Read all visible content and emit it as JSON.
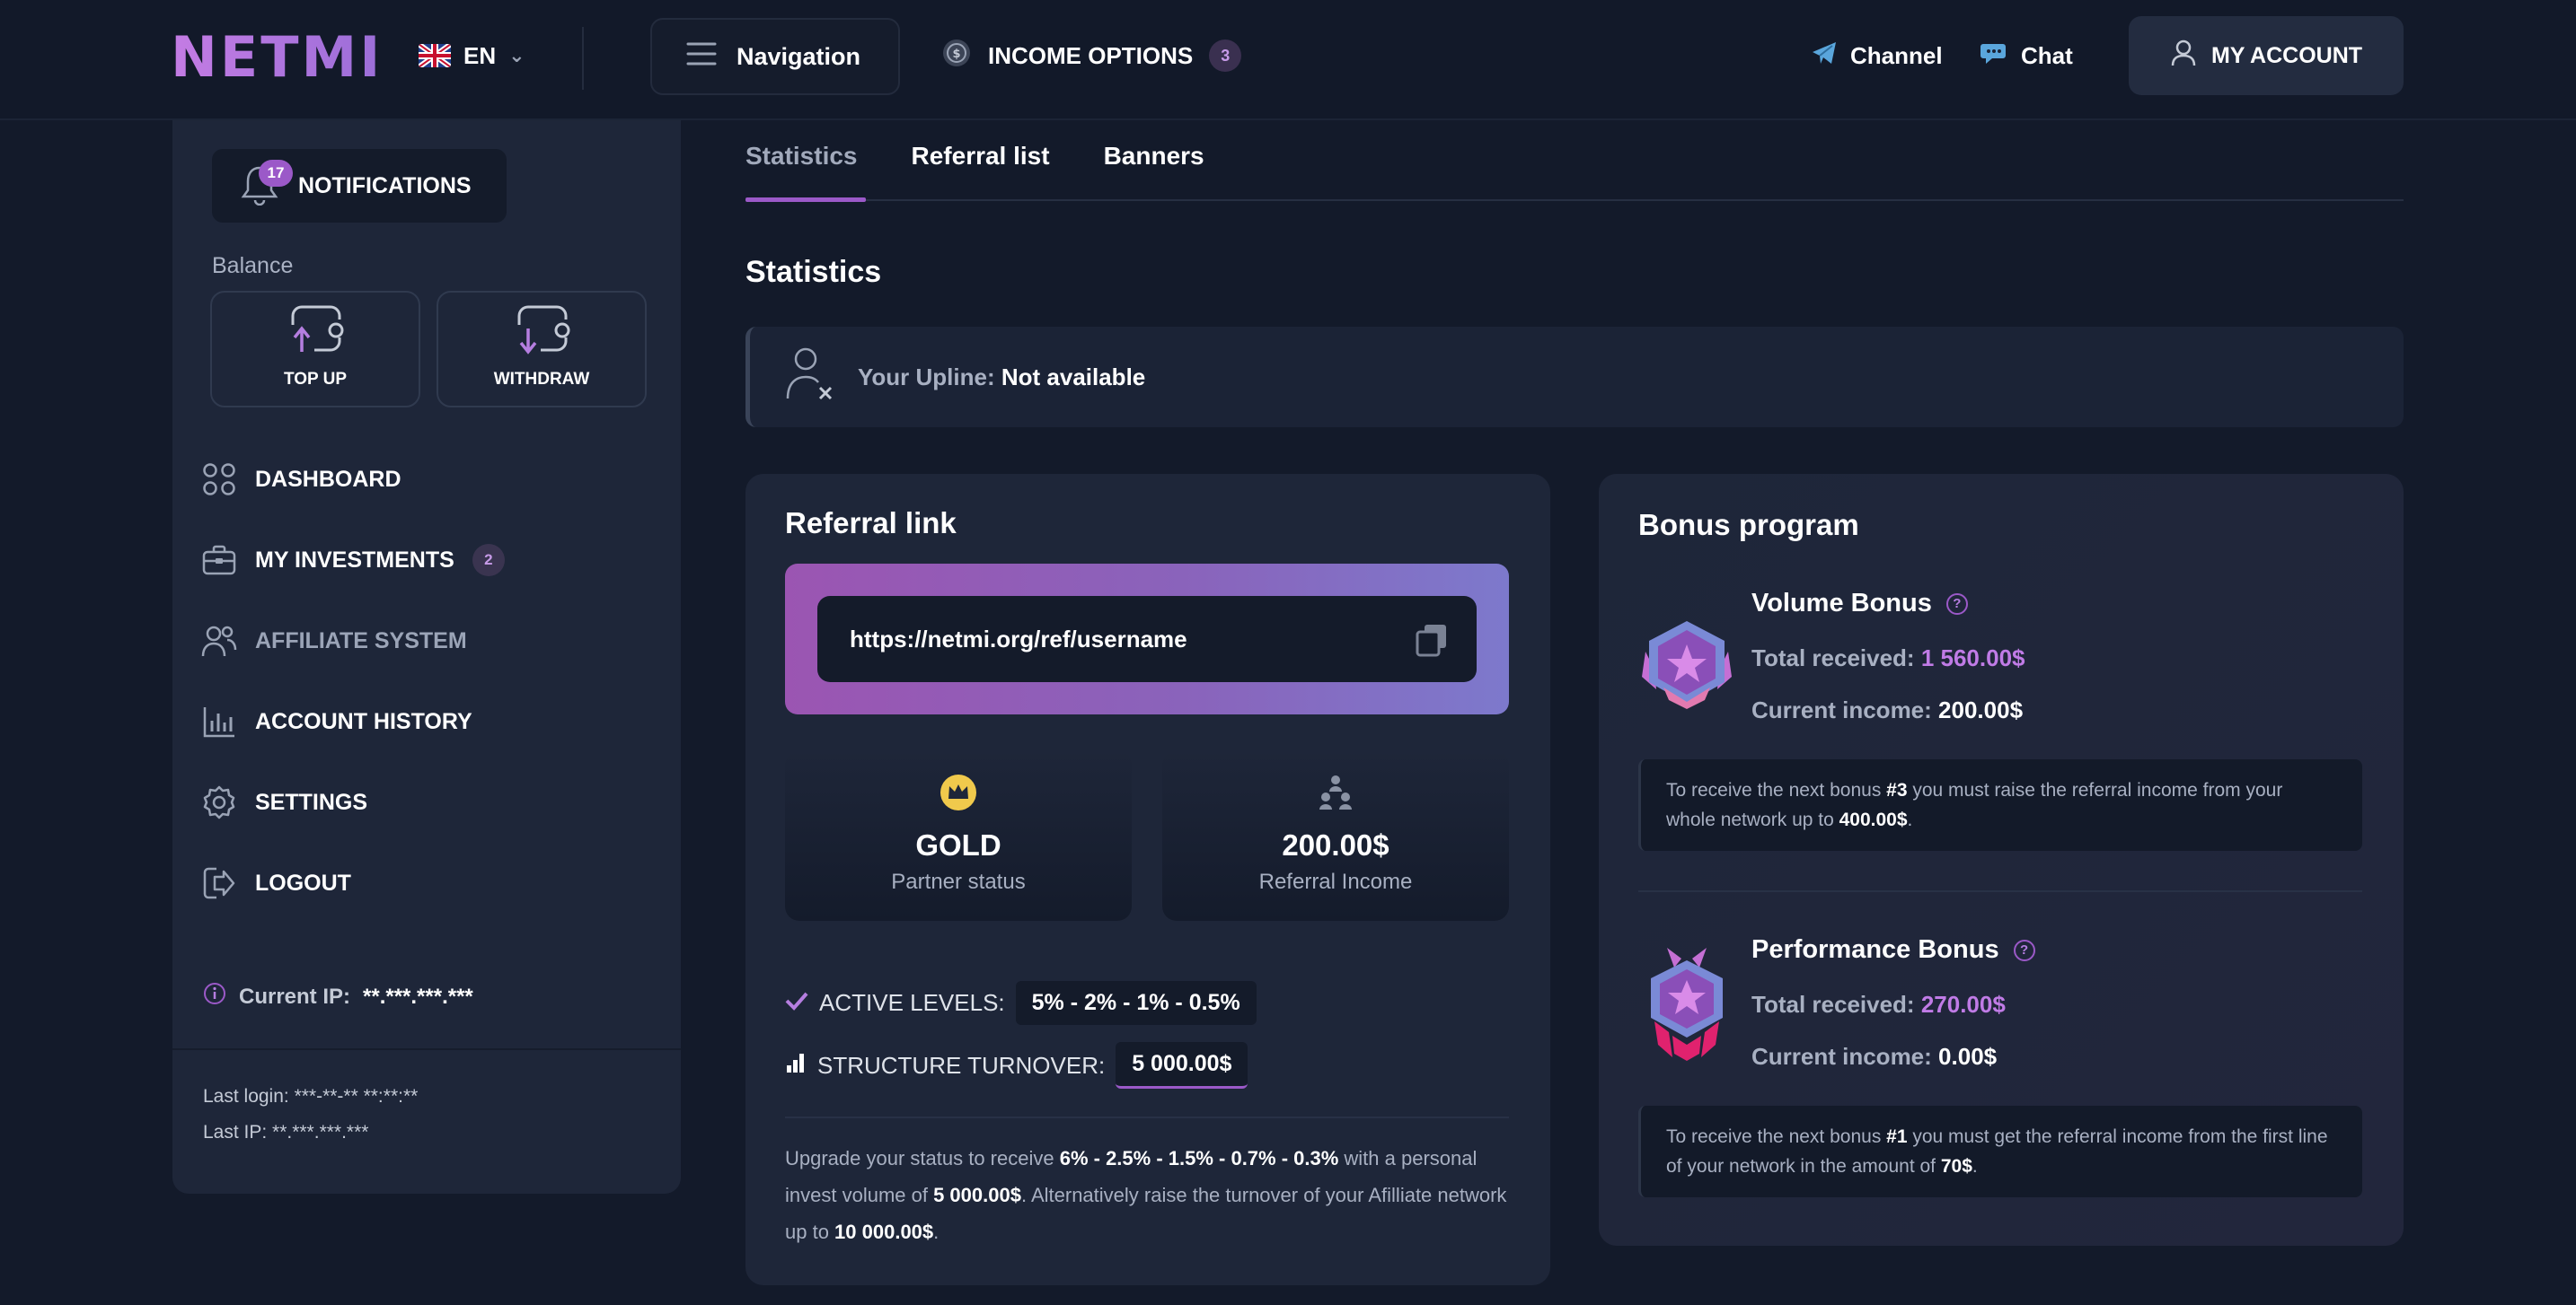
{
  "header": {
    "logo": "NETMI",
    "language": "EN",
    "navigation_label": "Navigation",
    "income_options_label": "INCOME OPTIONS",
    "income_options_count": "3",
    "channel_label": "Channel",
    "chat_label": "Chat",
    "account_label": "MY ACCOUNT"
  },
  "sidebar": {
    "notifications_label": "NOTIFICATIONS",
    "notifications_count": "17",
    "balance_label": "Balance",
    "top_up_label": "TOP UP",
    "withdraw_label": "WITHDRAW",
    "menu": [
      {
        "label": "DASHBOARD",
        "icon": "dashboard-icon"
      },
      {
        "label": "MY INVESTMENTS",
        "icon": "briefcase-icon",
        "badge": "2"
      },
      {
        "label": "AFFILIATE SYSTEM",
        "icon": "users-icon"
      },
      {
        "label": "ACCOUNT HISTORY",
        "icon": "bar-chart-icon"
      },
      {
        "label": "SETTINGS",
        "icon": "gear-icon"
      },
      {
        "label": "LOGOUT",
        "icon": "logout-icon"
      }
    ],
    "current_ip_label": "Current IP:",
    "current_ip_value": "**.***.***.***",
    "last_login": "Last login: ***-**-** **:**:**",
    "last_ip": "Last IP: **.***.***.***"
  },
  "tabs": [
    "Statistics",
    "Referral list",
    "Banners"
  ],
  "active_tab": "Statistics",
  "page_title": "Statistics",
  "upline": {
    "label": "Your Upline:",
    "value": "Not available"
  },
  "referral": {
    "title": "Referral link",
    "link": "https://netmi.org/ref/username",
    "partner_status_value": "GOLD",
    "partner_status_label": "Partner status",
    "referral_income_value": "200.00$",
    "referral_income_label": "Referral Income",
    "active_levels_label": "ACTIVE LEVELS:",
    "active_levels_value": "5% - 2% - 1% - 0.5%",
    "structure_turnover_label": "STRUCTURE TURNOVER:",
    "structure_turnover_value": "5 000.00$",
    "upgrade_text_1": "Upgrade your status to receive ",
    "upgrade_bold_1": "6% - 2.5% - 1.5% - 0.7% - 0.3%",
    "upgrade_text_2": " with a personal invest volume of ",
    "upgrade_bold_2": "5 000.00$",
    "upgrade_text_3": ". Alternatively raise the turnover of your Afilliate network up to ",
    "upgrade_bold_3": "10 000.00$",
    "upgrade_text_4": "."
  },
  "bonus": {
    "title": "Bonus program",
    "volume": {
      "name": "Volume Bonus",
      "total_label": "Total received:",
      "total_value": "1 560.00$",
      "current_label": "Current income:",
      "current_value": "200.00$",
      "note_1": "To receive the next bonus ",
      "note_b1": "#3",
      "note_2": " you must raise the referral income from your whole network up to ",
      "note_b2": "400.00$",
      "note_3": "."
    },
    "performance": {
      "name": "Performance Bonus",
      "total_label": "Total received:",
      "total_value": "270.00$",
      "current_label": "Current income:",
      "current_value": "0.00$",
      "note_1": "To receive the next bonus ",
      "note_b1": "#1",
      "note_2": " you must get the referral income from the first line of your network in the amount of ",
      "note_b2": "70$",
      "note_3": "."
    }
  },
  "colors": {
    "accent": "#9b59c8",
    "background": "#131a2a",
    "card": "#1e2639"
  }
}
